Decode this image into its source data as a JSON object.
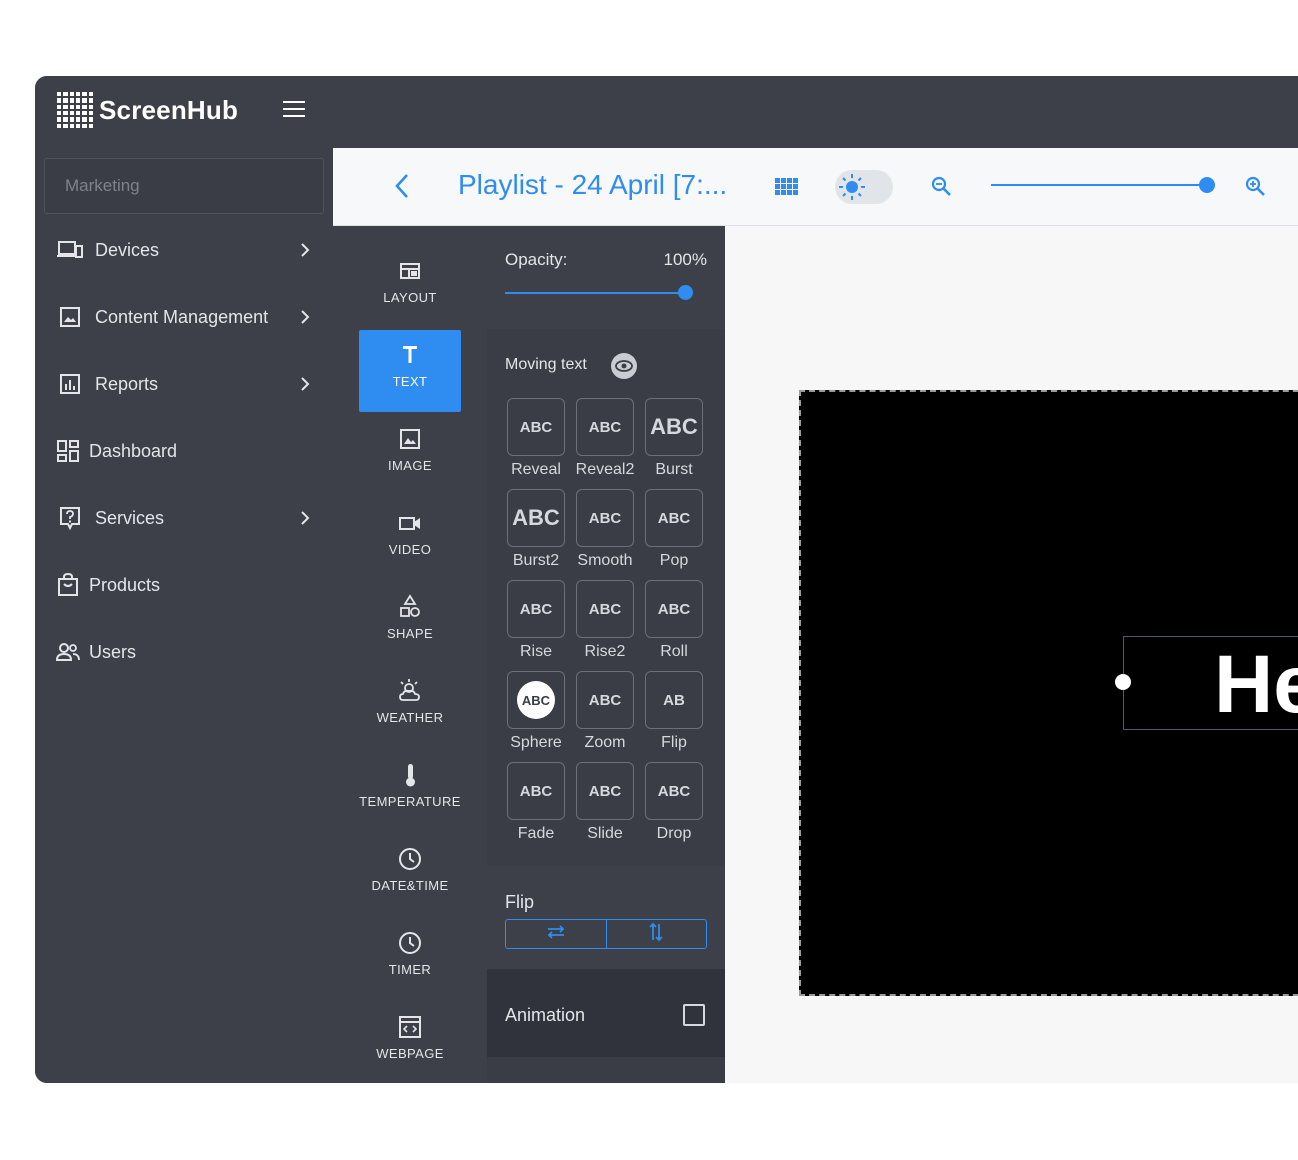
{
  "app": {
    "brand": "ScreenHub"
  },
  "sidebar": {
    "search_placeholder": "Marketing",
    "items": [
      {
        "label": "Devices",
        "icon": "devices-icon",
        "has_chevron": true
      },
      {
        "label": "Content Management",
        "icon": "image-icon",
        "has_chevron": true
      },
      {
        "label": "Reports",
        "icon": "chart-icon",
        "has_chevron": true
      },
      {
        "label": "Dashboard",
        "icon": "dashboard-icon",
        "has_chevron": false
      },
      {
        "label": "Services",
        "icon": "help-icon",
        "has_chevron": true
      },
      {
        "label": "Products",
        "icon": "bag-icon",
        "has_chevron": false
      },
      {
        "label": "Users",
        "icon": "users-icon",
        "has_chevron": false
      }
    ]
  },
  "editor": {
    "playlist_title": "Playlist - 24 April [7:...",
    "accent_color": "#2f8cf0"
  },
  "tools": [
    {
      "label": "LAYOUT",
      "icon": "layout-icon",
      "active": false
    },
    {
      "label": "TEXT",
      "icon": "text-icon",
      "active": true
    },
    {
      "label": "IMAGE",
      "icon": "image-icon",
      "active": false
    },
    {
      "label": "VIDEO",
      "icon": "video-icon",
      "active": false
    },
    {
      "label": "SHAPE",
      "icon": "shape-icon",
      "active": false
    },
    {
      "label": "WEATHER",
      "icon": "weather-icon",
      "active": false
    },
    {
      "label": "TEMPERATURE",
      "icon": "thermometer-icon",
      "active": false
    },
    {
      "label": "DATE&TIME",
      "icon": "clock-icon",
      "active": false
    },
    {
      "label": "TIMER",
      "icon": "timer-icon",
      "active": false
    },
    {
      "label": "WEBPAGE",
      "icon": "webpage-icon",
      "active": false
    }
  ],
  "properties": {
    "opacity_label": "Opacity:",
    "opacity_value": "100%",
    "moving_text_label": "Moving text",
    "effects": [
      {
        "label": "Reveal",
        "glyph": "ABC"
      },
      {
        "label": "Reveal2",
        "glyph": "ABC"
      },
      {
        "label": "Burst",
        "glyph": "ABC"
      },
      {
        "label": "Burst2",
        "glyph": "ABC"
      },
      {
        "label": "Smooth",
        "glyph": "ABC"
      },
      {
        "label": "Pop",
        "glyph": "ABC"
      },
      {
        "label": "Rise",
        "glyph": "ABC"
      },
      {
        "label": "Rise2",
        "glyph": "ABC"
      },
      {
        "label": "Roll",
        "glyph": "ABC"
      },
      {
        "label": "Sphere",
        "glyph": "ABC"
      },
      {
        "label": "Zoom",
        "glyph": "ABC"
      },
      {
        "label": "Flip",
        "glyph": "AB"
      },
      {
        "label": "Fade",
        "glyph": "ABC"
      },
      {
        "label": "Slide",
        "glyph": "ABC"
      },
      {
        "label": "Drop",
        "glyph": "ABC"
      }
    ],
    "flip_label": "Flip",
    "animation_label": "Animation"
  },
  "canvas": {
    "text_content": "He"
  }
}
